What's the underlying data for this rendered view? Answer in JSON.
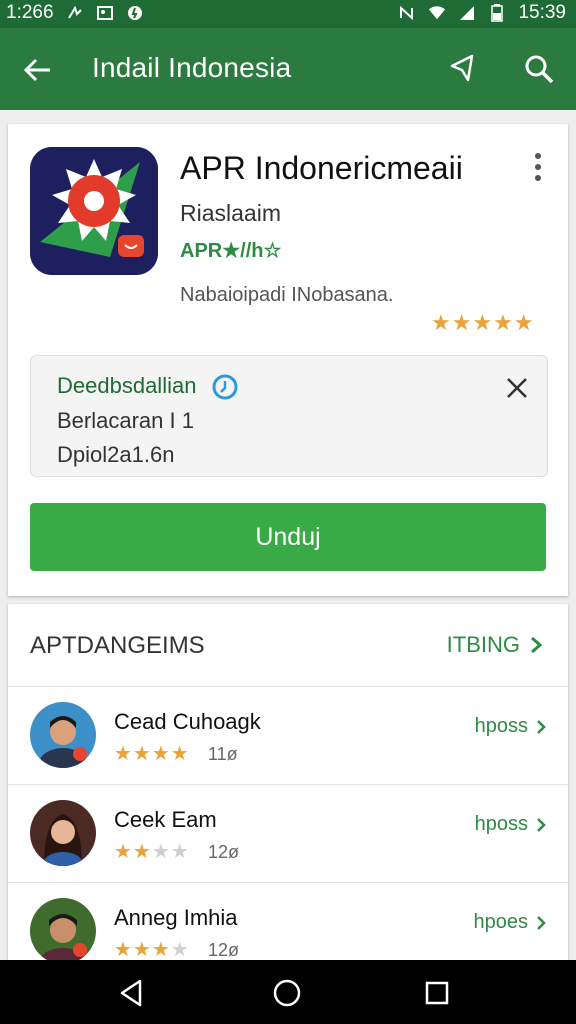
{
  "status_bar": {
    "time_left": "1:266",
    "time_right": "15:39"
  },
  "app_bar": {
    "title": "Indail Indonesia"
  },
  "app": {
    "name": "APR Indonericmeaii",
    "developer": "Riaslaaim",
    "tagline": "APR★//h☆",
    "subtitle": "Nabaioipadi INobasana.",
    "rating_stars": "★★★★★"
  },
  "notice": {
    "title": "Deedbsdallian",
    "line1": "Berlacaran I 1",
    "line2": "Dpiol2a1.6n"
  },
  "install": {
    "label": "Unduj"
  },
  "section": {
    "title": "APTDANGEIMS",
    "more_label": "ITBING"
  },
  "reviews": [
    {
      "name": "Cead Cuhoagk",
      "stars": "★★★★",
      "count": "11ø",
      "action": "hposs",
      "rating": 4
    },
    {
      "name": "Ceek Eam",
      "stars": "★★★★",
      "count": "12ø",
      "action": "hposs",
      "rating": 2.5
    },
    {
      "name": "Anneg Imhia",
      "stars": "★★★★",
      "count": "12ø",
      "action": "hpoes",
      "rating": 3
    }
  ],
  "colors": {
    "status_bar": "#1e6b35",
    "app_bar": "#2b7b40",
    "accent_green": "#3aaa47",
    "star": "#e8a33a"
  }
}
